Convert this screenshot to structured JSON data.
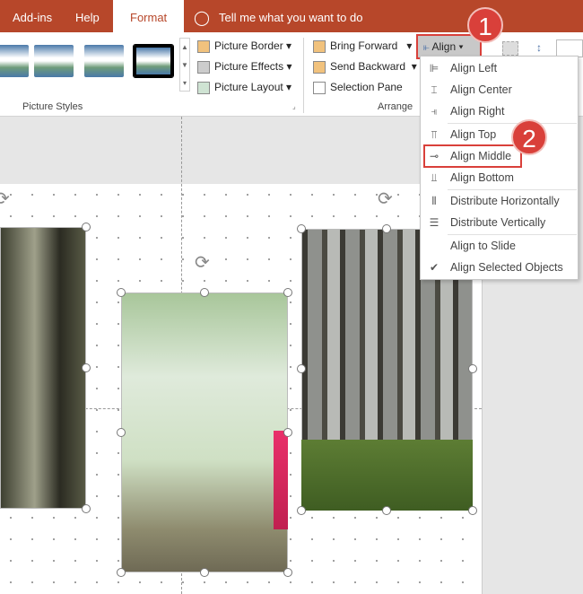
{
  "tabs": [
    {
      "label": "Add-ins"
    },
    {
      "label": "Help"
    },
    {
      "label": "Format",
      "active": true
    }
  ],
  "tell_me": "Tell me what you want to do",
  "ribbon": {
    "picture_border": "Picture Border",
    "picture_effects": "Picture Effects",
    "picture_layout": "Picture Layout",
    "picture_styles_group": "Picture Styles",
    "bring_forward": "Bring Forward",
    "send_backward": "Send Backward",
    "selection_pane": "Selection Pane",
    "arrange_group": "Arrange",
    "align": "Align"
  },
  "align_menu": [
    {
      "label": "Align Left",
      "icon": "align-left-icon"
    },
    {
      "label": "Align Center",
      "icon": "align-center-icon"
    },
    {
      "label": "Align Right",
      "icon": "align-right-icon"
    },
    {
      "label": "Align Top",
      "icon": "align-top-icon"
    },
    {
      "label": "Align Middle",
      "icon": "align-middle-icon",
      "highlighted": true
    },
    {
      "label": "Align Bottom",
      "icon": "align-bottom-icon"
    },
    {
      "label": "Distribute Horizontally",
      "icon": "distribute-horizontally-icon"
    },
    {
      "label": "Distribute Vertically",
      "icon": "distribute-vertically-icon"
    },
    {
      "label": "Align to Slide",
      "icon": ""
    },
    {
      "label": "Align Selected Objects",
      "icon": "check-icon",
      "checked": true
    }
  ],
  "badges": [
    "1",
    "2"
  ],
  "colors": {
    "accent": "#b7472a",
    "badge": "#d9403a"
  }
}
